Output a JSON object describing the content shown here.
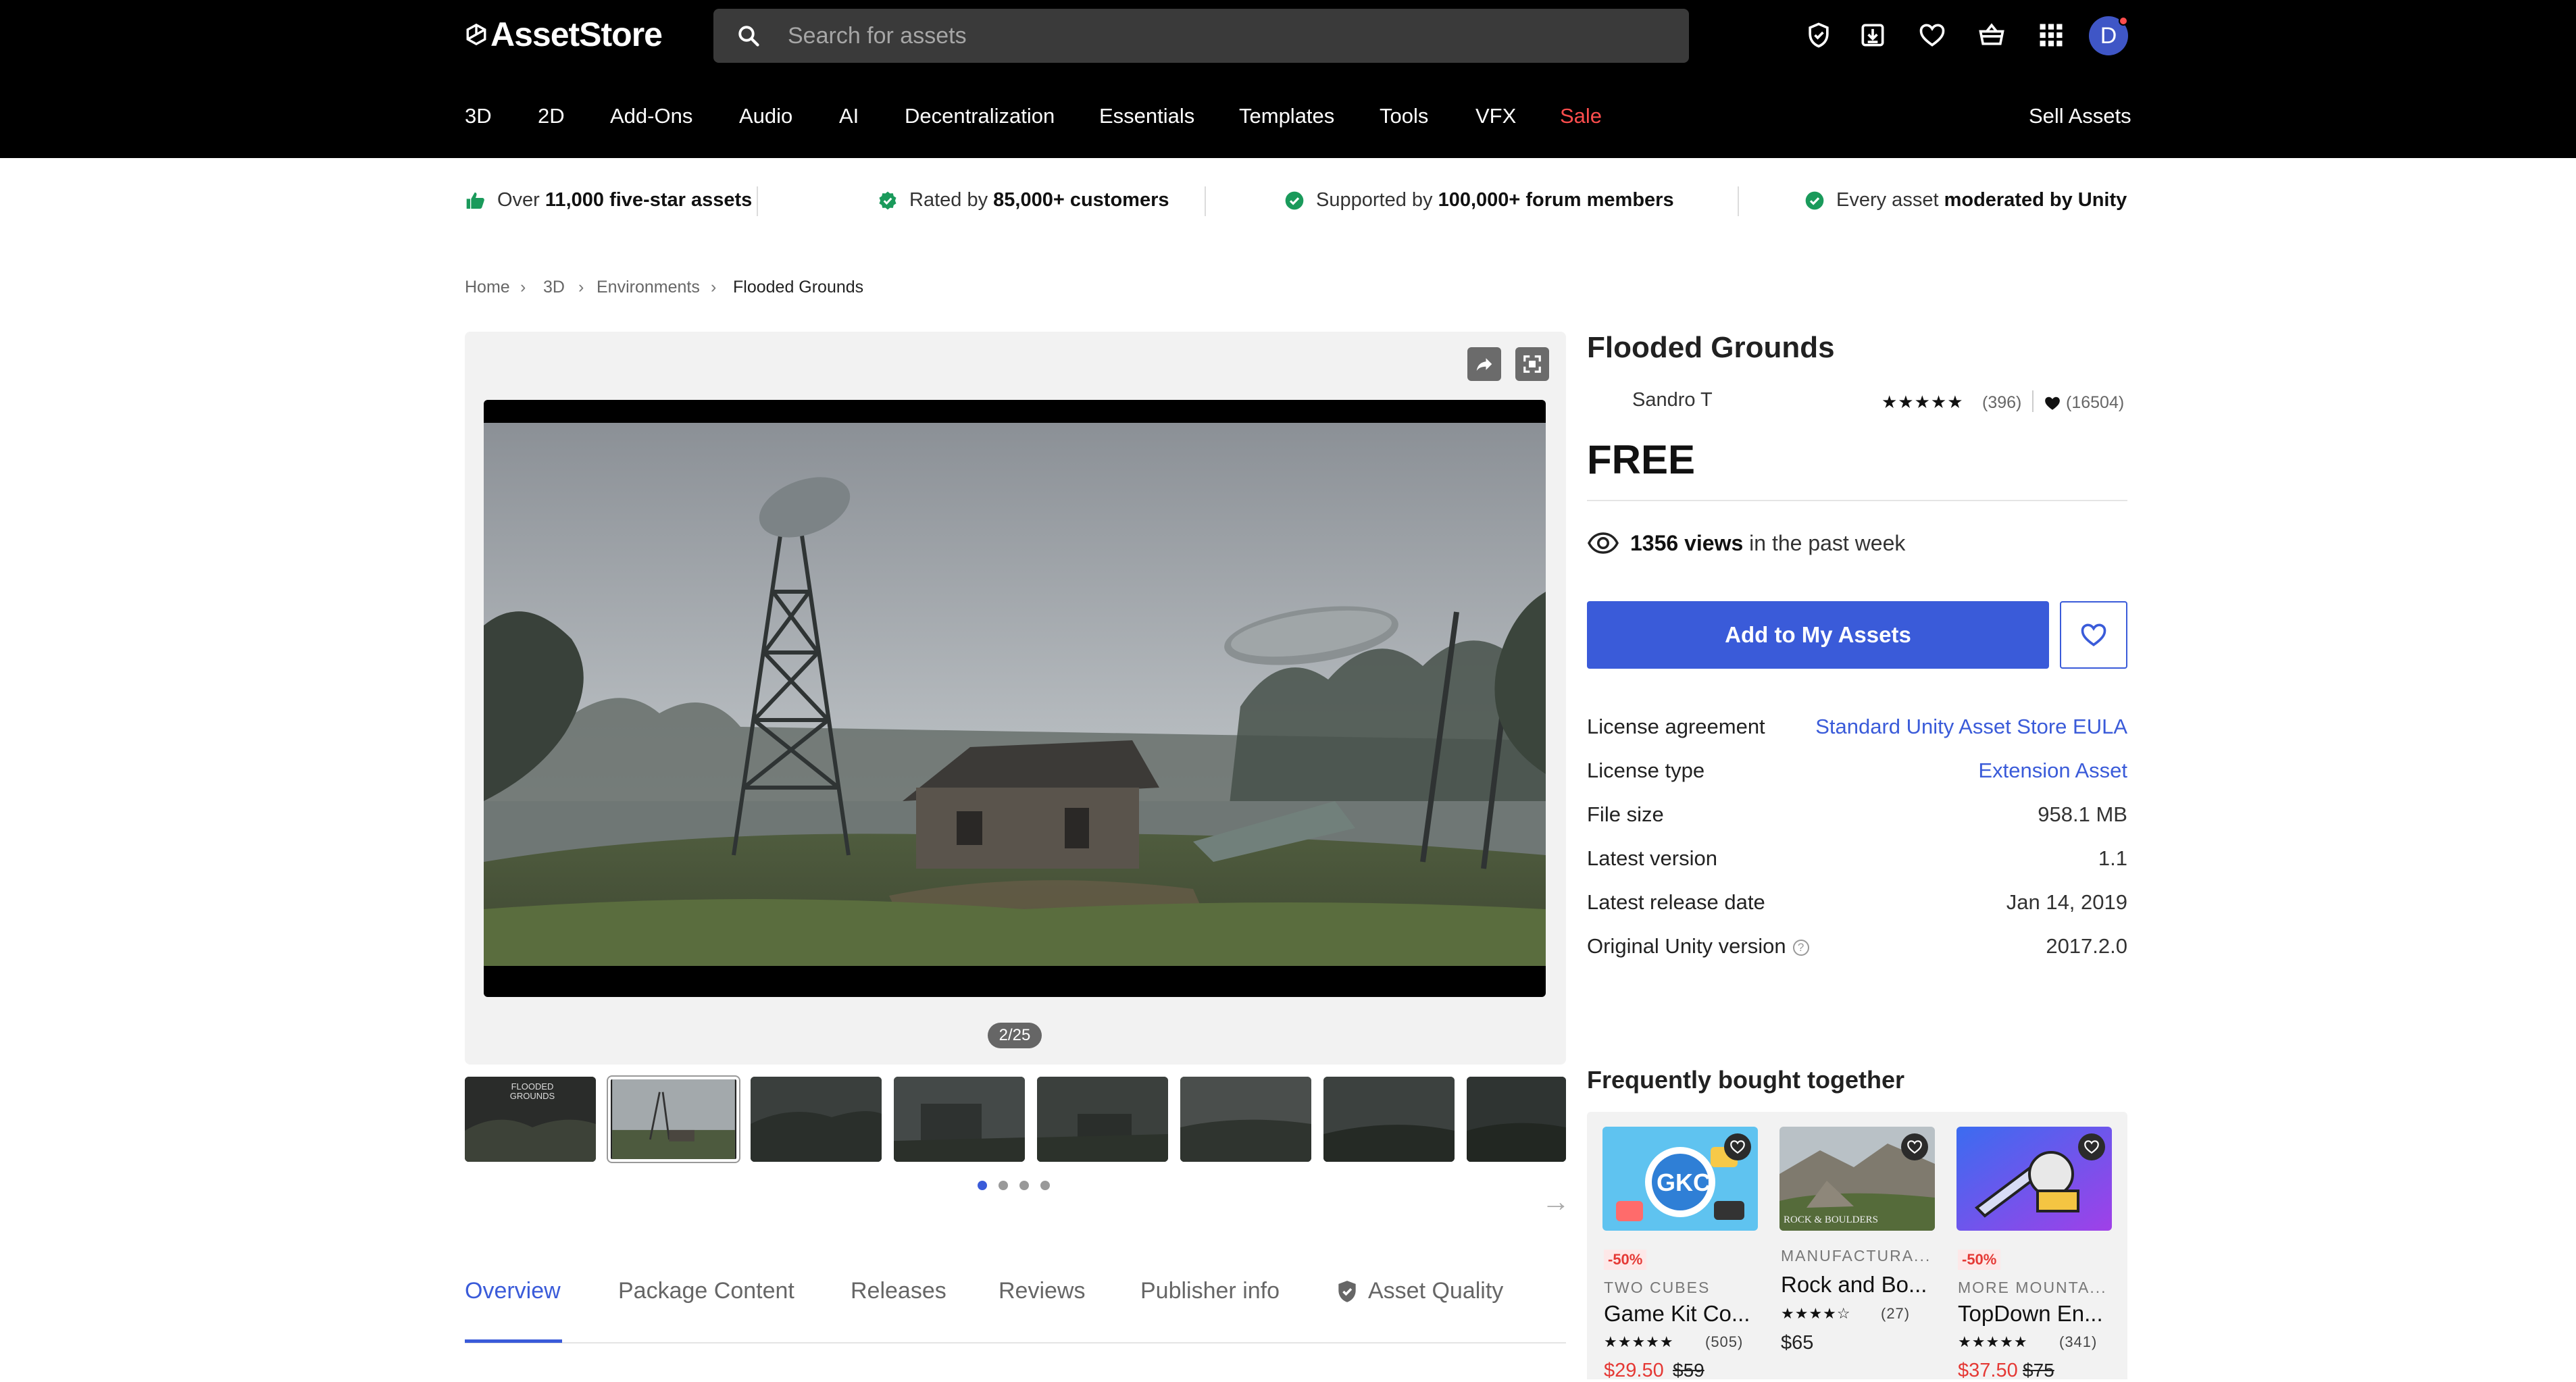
{
  "header": {
    "logo": "AssetStore",
    "search_placeholder": "Search for assets",
    "avatar_initial": "D",
    "nav": [
      "3D",
      "2D",
      "Add-Ons",
      "Audio",
      "AI",
      "Decentralization",
      "Essentials",
      "Templates",
      "Tools",
      "VFX",
      "Sale"
    ],
    "sell_assets": "Sell Assets",
    "icons": [
      "shield-check-icon",
      "download-icon",
      "heart-icon",
      "basket-icon",
      "apps-grid-icon"
    ]
  },
  "trust": [
    {
      "pre": "Over",
      "bold": "11,000 five-star assets",
      "post": ""
    },
    {
      "pre": "Rated by",
      "bold": "85,000+ customers",
      "post": ""
    },
    {
      "pre": "Supported by",
      "bold": "100,000+ forum members",
      "post": ""
    },
    {
      "pre": "Every asset",
      "bold": "moderated by Unity",
      "post": ""
    }
  ],
  "breadcrumb": [
    "Home",
    "3D",
    "Environments",
    "Flooded Grounds"
  ],
  "media": {
    "counter": "2/25",
    "thumb_label": "FLOODED GROUNDS",
    "active_dot": 0,
    "dot_count": 4
  },
  "tabs": [
    "Overview",
    "Package Content",
    "Releases",
    "Reviews",
    "Publisher info",
    "Asset Quality"
  ],
  "product": {
    "title": "Flooded Grounds",
    "publisher": "Sandro T",
    "rating_stars": "★★★★★",
    "rating_count": "(396)",
    "favorites": "(16504)",
    "price": "FREE",
    "views_count": "1356 views",
    "views_suffix": "in the past week",
    "add_button": "Add to My Assets",
    "details": [
      {
        "label": "License agreement",
        "value": "Standard Unity Asset Store EULA",
        "link": true
      },
      {
        "label": "License type",
        "value": "Extension Asset",
        "link": true
      },
      {
        "label": "File size",
        "value": "958.1 MB",
        "link": false
      },
      {
        "label": "Latest version",
        "value": "1.1",
        "link": false
      },
      {
        "label": "Latest release date",
        "value": "Jan 14, 2019",
        "link": false
      },
      {
        "label": "Original Unity version",
        "value": "2017.2.0",
        "link": false
      }
    ]
  },
  "fbt": {
    "title": "Frequently bought together",
    "cards": [
      {
        "discount": "-50%",
        "publisher": "TWO CUBES",
        "name": "Game Kit Co...",
        "stars": "★★★★★",
        "count": "(505)",
        "price": "$29.50",
        "old": "$59",
        "image_text": "GKC"
      },
      {
        "discount": "",
        "publisher": "MANUFACTURA...",
        "name": "Rock and Bo...",
        "stars": "★★★★☆",
        "count": "(27)",
        "price": "$65",
        "old": "",
        "image_text": "ROCK & BOULDERS"
      },
      {
        "discount": "-50%",
        "publisher": "MORE MOUNTA...",
        "name": "TopDown En...",
        "stars": "★★★★★",
        "count": "(341)",
        "price": "$37.50",
        "old": "$75",
        "image_text": ""
      }
    ]
  },
  "colors": {
    "accent": "#3a5bd9",
    "sale": "#ff4d4d",
    "trust_check": "#1a9a5b"
  }
}
